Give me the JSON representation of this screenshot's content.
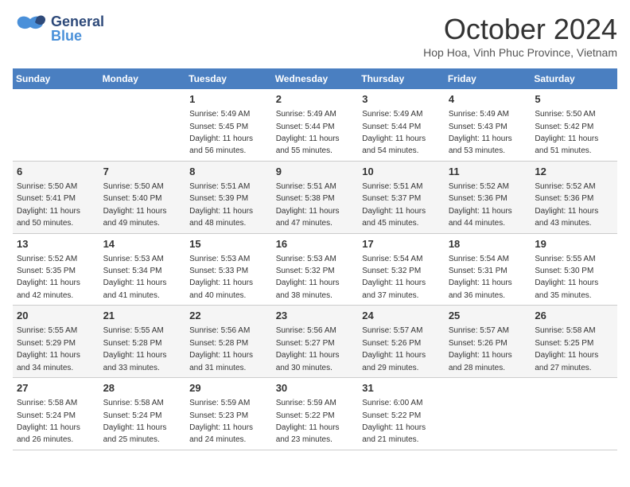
{
  "header": {
    "logo_general": "General",
    "logo_blue": "Blue",
    "month": "October 2024",
    "location": "Hop Hoa, Vinh Phuc Province, Vietnam"
  },
  "days_of_week": [
    "Sunday",
    "Monday",
    "Tuesday",
    "Wednesday",
    "Thursday",
    "Friday",
    "Saturday"
  ],
  "weeks": [
    [
      {
        "num": "",
        "sunrise": "",
        "sunset": "",
        "daylight": ""
      },
      {
        "num": "",
        "sunrise": "",
        "sunset": "",
        "daylight": ""
      },
      {
        "num": "1",
        "sunrise": "Sunrise: 5:49 AM",
        "sunset": "Sunset: 5:45 PM",
        "daylight": "Daylight: 11 hours and 56 minutes."
      },
      {
        "num": "2",
        "sunrise": "Sunrise: 5:49 AM",
        "sunset": "Sunset: 5:44 PM",
        "daylight": "Daylight: 11 hours and 55 minutes."
      },
      {
        "num": "3",
        "sunrise": "Sunrise: 5:49 AM",
        "sunset": "Sunset: 5:44 PM",
        "daylight": "Daylight: 11 hours and 54 minutes."
      },
      {
        "num": "4",
        "sunrise": "Sunrise: 5:49 AM",
        "sunset": "Sunset: 5:43 PM",
        "daylight": "Daylight: 11 hours and 53 minutes."
      },
      {
        "num": "5",
        "sunrise": "Sunrise: 5:50 AM",
        "sunset": "Sunset: 5:42 PM",
        "daylight": "Daylight: 11 hours and 51 minutes."
      }
    ],
    [
      {
        "num": "6",
        "sunrise": "Sunrise: 5:50 AM",
        "sunset": "Sunset: 5:41 PM",
        "daylight": "Daylight: 11 hours and 50 minutes."
      },
      {
        "num": "7",
        "sunrise": "Sunrise: 5:50 AM",
        "sunset": "Sunset: 5:40 PM",
        "daylight": "Daylight: 11 hours and 49 minutes."
      },
      {
        "num": "8",
        "sunrise": "Sunrise: 5:51 AM",
        "sunset": "Sunset: 5:39 PM",
        "daylight": "Daylight: 11 hours and 48 minutes."
      },
      {
        "num": "9",
        "sunrise": "Sunrise: 5:51 AM",
        "sunset": "Sunset: 5:38 PM",
        "daylight": "Daylight: 11 hours and 47 minutes."
      },
      {
        "num": "10",
        "sunrise": "Sunrise: 5:51 AM",
        "sunset": "Sunset: 5:37 PM",
        "daylight": "Daylight: 11 hours and 45 minutes."
      },
      {
        "num": "11",
        "sunrise": "Sunrise: 5:52 AM",
        "sunset": "Sunset: 5:36 PM",
        "daylight": "Daylight: 11 hours and 44 minutes."
      },
      {
        "num": "12",
        "sunrise": "Sunrise: 5:52 AM",
        "sunset": "Sunset: 5:36 PM",
        "daylight": "Daylight: 11 hours and 43 minutes."
      }
    ],
    [
      {
        "num": "13",
        "sunrise": "Sunrise: 5:52 AM",
        "sunset": "Sunset: 5:35 PM",
        "daylight": "Daylight: 11 hours and 42 minutes."
      },
      {
        "num": "14",
        "sunrise": "Sunrise: 5:53 AM",
        "sunset": "Sunset: 5:34 PM",
        "daylight": "Daylight: 11 hours and 41 minutes."
      },
      {
        "num": "15",
        "sunrise": "Sunrise: 5:53 AM",
        "sunset": "Sunset: 5:33 PM",
        "daylight": "Daylight: 11 hours and 40 minutes."
      },
      {
        "num": "16",
        "sunrise": "Sunrise: 5:53 AM",
        "sunset": "Sunset: 5:32 PM",
        "daylight": "Daylight: 11 hours and 38 minutes."
      },
      {
        "num": "17",
        "sunrise": "Sunrise: 5:54 AM",
        "sunset": "Sunset: 5:32 PM",
        "daylight": "Daylight: 11 hours and 37 minutes."
      },
      {
        "num": "18",
        "sunrise": "Sunrise: 5:54 AM",
        "sunset": "Sunset: 5:31 PM",
        "daylight": "Daylight: 11 hours and 36 minutes."
      },
      {
        "num": "19",
        "sunrise": "Sunrise: 5:55 AM",
        "sunset": "Sunset: 5:30 PM",
        "daylight": "Daylight: 11 hours and 35 minutes."
      }
    ],
    [
      {
        "num": "20",
        "sunrise": "Sunrise: 5:55 AM",
        "sunset": "Sunset: 5:29 PM",
        "daylight": "Daylight: 11 hours and 34 minutes."
      },
      {
        "num": "21",
        "sunrise": "Sunrise: 5:55 AM",
        "sunset": "Sunset: 5:28 PM",
        "daylight": "Daylight: 11 hours and 33 minutes."
      },
      {
        "num": "22",
        "sunrise": "Sunrise: 5:56 AM",
        "sunset": "Sunset: 5:28 PM",
        "daylight": "Daylight: 11 hours and 31 minutes."
      },
      {
        "num": "23",
        "sunrise": "Sunrise: 5:56 AM",
        "sunset": "Sunset: 5:27 PM",
        "daylight": "Daylight: 11 hours and 30 minutes."
      },
      {
        "num": "24",
        "sunrise": "Sunrise: 5:57 AM",
        "sunset": "Sunset: 5:26 PM",
        "daylight": "Daylight: 11 hours and 29 minutes."
      },
      {
        "num": "25",
        "sunrise": "Sunrise: 5:57 AM",
        "sunset": "Sunset: 5:26 PM",
        "daylight": "Daylight: 11 hours and 28 minutes."
      },
      {
        "num": "26",
        "sunrise": "Sunrise: 5:58 AM",
        "sunset": "Sunset: 5:25 PM",
        "daylight": "Daylight: 11 hours and 27 minutes."
      }
    ],
    [
      {
        "num": "27",
        "sunrise": "Sunrise: 5:58 AM",
        "sunset": "Sunset: 5:24 PM",
        "daylight": "Daylight: 11 hours and 26 minutes."
      },
      {
        "num": "28",
        "sunrise": "Sunrise: 5:58 AM",
        "sunset": "Sunset: 5:24 PM",
        "daylight": "Daylight: 11 hours and 25 minutes."
      },
      {
        "num": "29",
        "sunrise": "Sunrise: 5:59 AM",
        "sunset": "Sunset: 5:23 PM",
        "daylight": "Daylight: 11 hours and 24 minutes."
      },
      {
        "num": "30",
        "sunrise": "Sunrise: 5:59 AM",
        "sunset": "Sunset: 5:22 PM",
        "daylight": "Daylight: 11 hours and 23 minutes."
      },
      {
        "num": "31",
        "sunrise": "Sunrise: 6:00 AM",
        "sunset": "Sunset: 5:22 PM",
        "daylight": "Daylight: 11 hours and 21 minutes."
      },
      {
        "num": "",
        "sunrise": "",
        "sunset": "",
        "daylight": ""
      },
      {
        "num": "",
        "sunrise": "",
        "sunset": "",
        "daylight": ""
      }
    ]
  ]
}
